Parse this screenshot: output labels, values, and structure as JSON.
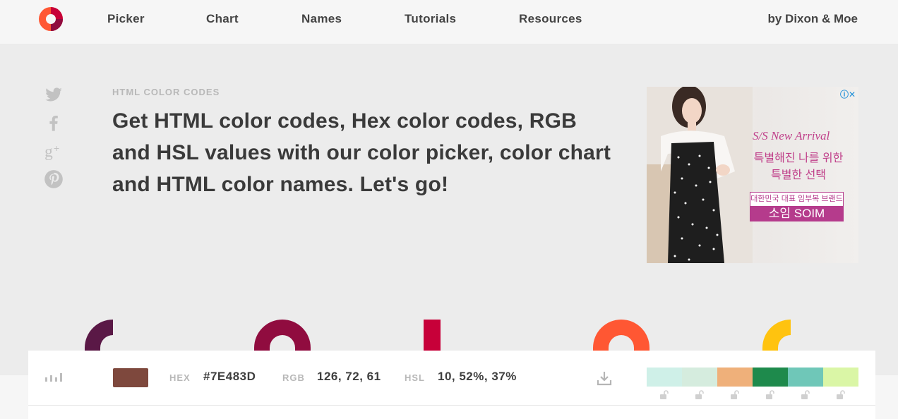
{
  "nav": {
    "items": [
      {
        "label": "Picker"
      },
      {
        "label": "Chart"
      },
      {
        "label": "Names"
      },
      {
        "label": "Tutorials"
      },
      {
        "label": "Resources"
      }
    ],
    "byline": "by Dixon & Moe",
    "logo_icon": "logo-ring-icon"
  },
  "social": {
    "icons": [
      "twitter-icon",
      "facebook-icon",
      "google-plus-icon",
      "pinterest-icon"
    ]
  },
  "hero": {
    "eyebrow": "HTML COLOR CODES",
    "headline": "Get HTML color codes, Hex color codes, RGB and HSL values with our color picker, color chart and HTML color names. Let's go!"
  },
  "ad": {
    "info_icon": "ad-info-close-icon",
    "line1": "S/S New Arrival",
    "line2": "특별해진 나를 위한 특별한 선택",
    "badge_top": "대한민국 대표 임부복 브랜드",
    "badge_bottom": "소임 SOIM"
  },
  "colorbar": {
    "swatch_color": "#7E483D",
    "hex_label": "HEX",
    "hex_value": "#7E483D",
    "rgb_label": "RGB",
    "rgb_value": "126, 72, 61",
    "hsl_label": "HSL",
    "hsl_value": "10, 52%, 37%",
    "palette": [
      "#CFF0E8",
      "#D5ECDE",
      "#EFB07A",
      "#1E8A4C",
      "#6FC7B8",
      "#DAF6A6"
    ]
  },
  "colors": {
    "deco": [
      "#5A1846",
      "#900C3F",
      "#C70039",
      "#FF5733",
      "#FFC30F"
    ]
  }
}
